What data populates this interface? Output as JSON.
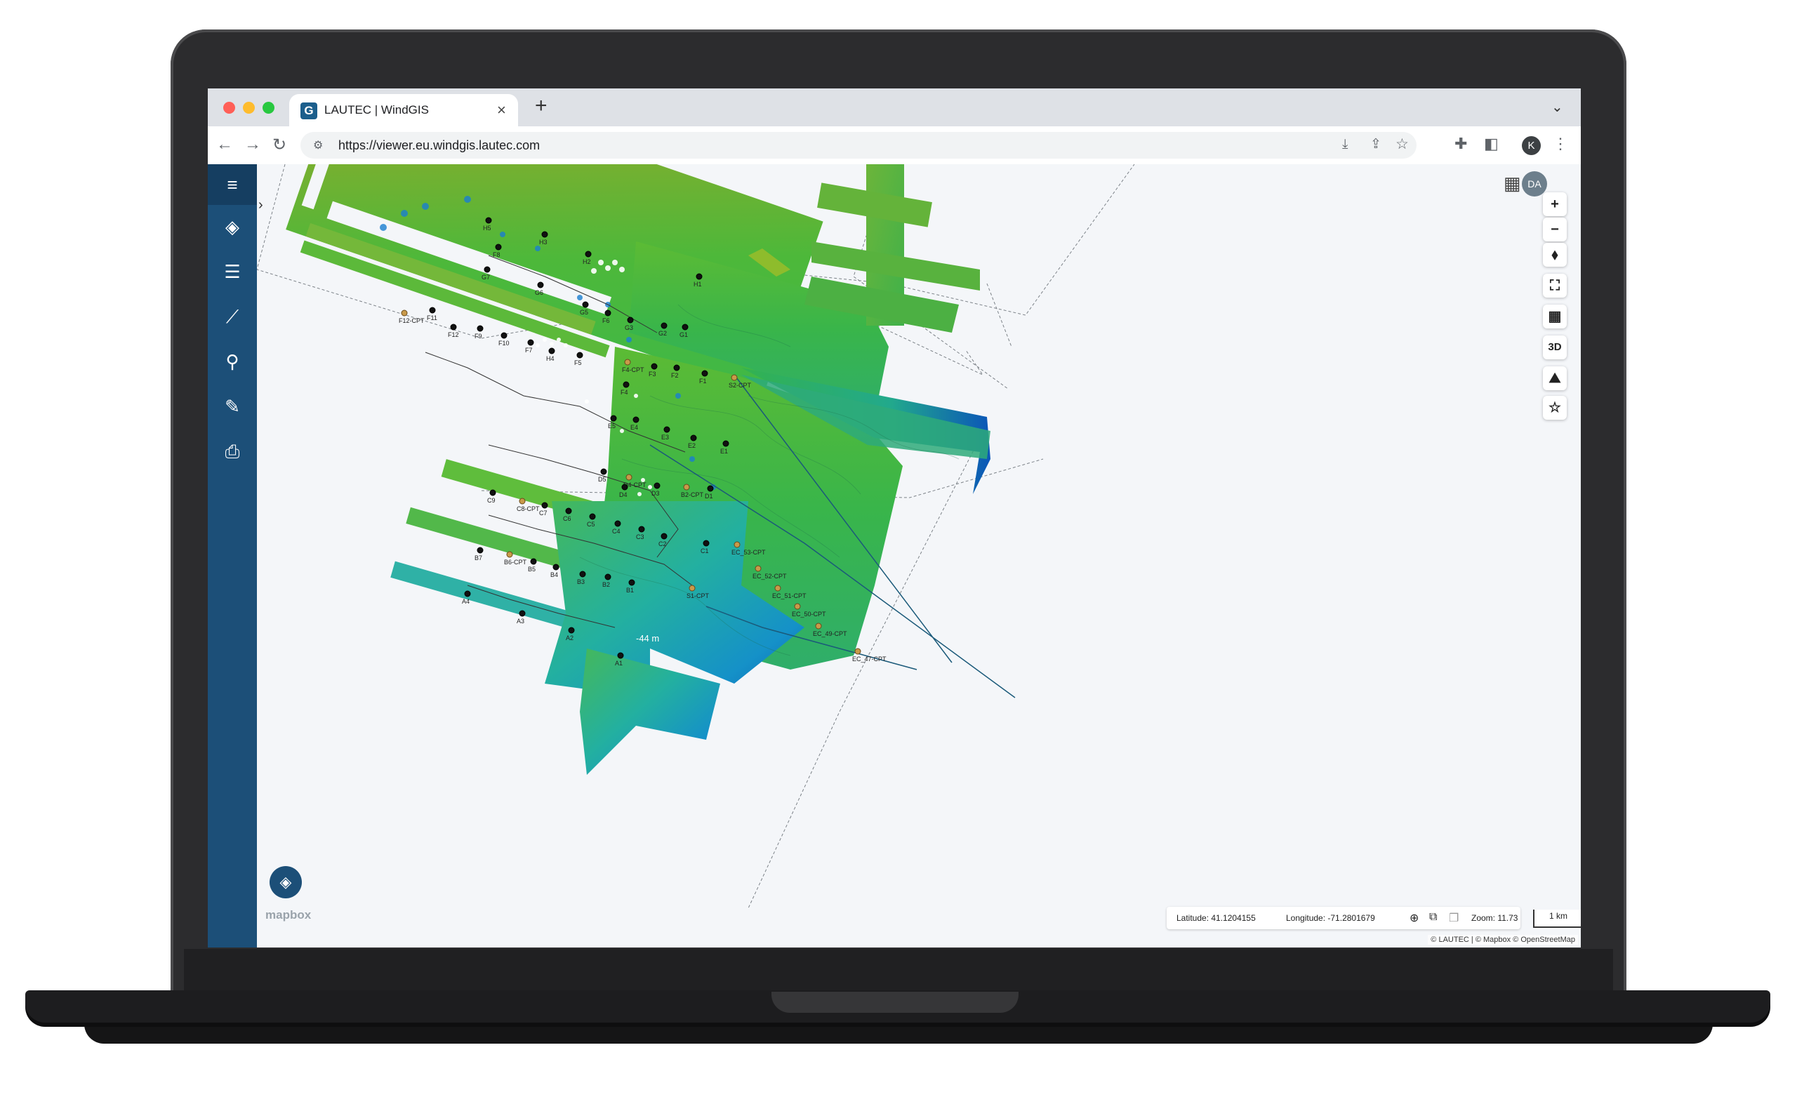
{
  "browser": {
    "tab_title": "LAUTEC | WindGIS",
    "tab_logo": "G",
    "url": "https://viewer.eu.windgis.lautec.com",
    "profile_initial": "K",
    "traffic_lights": [
      "#ff5f57",
      "#febc2e",
      "#28c840"
    ]
  },
  "sidebar": {
    "items": [
      {
        "name": "menu",
        "icon": "≡"
      },
      {
        "name": "layers",
        "icon": "◈"
      },
      {
        "name": "list",
        "icon": "☰"
      },
      {
        "name": "chart",
        "icon": "⟋"
      },
      {
        "name": "search",
        "icon": "⚲"
      },
      {
        "name": "measure",
        "icon": "✎"
      },
      {
        "name": "print",
        "icon": "⎙"
      }
    ],
    "color": "#1c4f78"
  },
  "map": {
    "user_initials": "DA",
    "controls": {
      "zoom_in": "+",
      "zoom_out": "−",
      "compass": "⬧",
      "fullscreen": "⛶",
      "basemap": "▦",
      "three_d": "3D",
      "terrain": "⛰",
      "favorite": "☆"
    },
    "coords": {
      "latitude": "Latitude: 41.1204155",
      "longitude": "Longitude: -71.2801679",
      "zoom": "Zoom: 11.73"
    },
    "scale": "1 km",
    "attribution": "© LAUTEC | © Mapbox © OpenStreetMap",
    "mapbox": "mapbox",
    "depth_label": "-44 m",
    "turbines": [
      "H5",
      "H3",
      "H2",
      "H1",
      "F8",
      "G7",
      "G6",
      "G5",
      "F6",
      "G3",
      "G2",
      "G1",
      "F12-CPT",
      "F11",
      "F12",
      "F9",
      "F10",
      "F7",
      "H4",
      "F5",
      "F4-CPT",
      "F3",
      "F2",
      "F1",
      "S2-CPT",
      "F4",
      "E5",
      "E4",
      "E3",
      "E2",
      "E1",
      "D5",
      "D4-CPT",
      "D4",
      "D3",
      "B2-CPT",
      "D1",
      "C9",
      "C8-CPT",
      "C7",
      "C6",
      "C5",
      "C4",
      "C3",
      "C2",
      "C1",
      "EC_53-CPT",
      "B7",
      "B6-CPT",
      "B5",
      "B4",
      "B3",
      "B2",
      "B1",
      "EC_52-CPT",
      "EC_51-CPT",
      "EC_50-CPT",
      "EC_49-CPT",
      "A4",
      "A3",
      "A2",
      "A1",
      "S1-CPT",
      "EC_47-CPT"
    ]
  }
}
